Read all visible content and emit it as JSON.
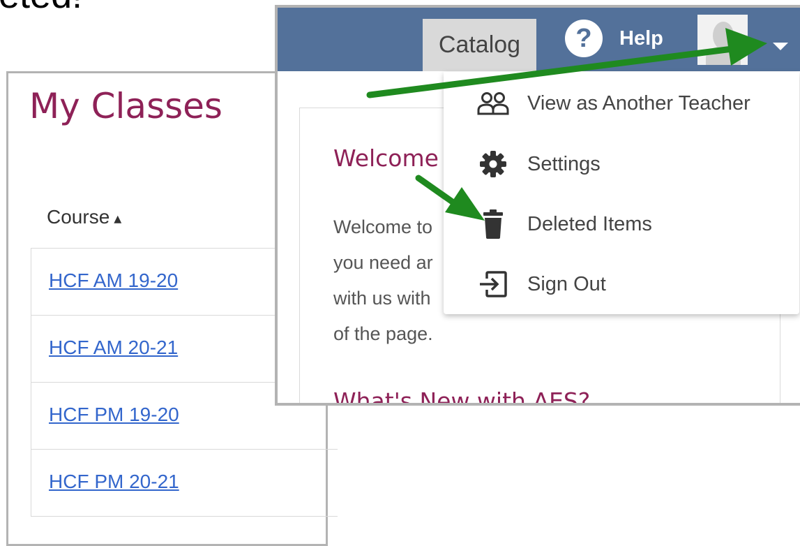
{
  "partial_heading": "eted!",
  "my_classes": {
    "title": "My Classes",
    "column_header": "Course",
    "courses": [
      "HCF AM 19-20",
      "HCF AM 20-21",
      "HCF PM 19-20",
      "HCF PM 20-21"
    ]
  },
  "navbar": {
    "catalog_label": "Catalog",
    "help_label": "Help",
    "help_icon_glyph": "?",
    "background_color": "#53719a"
  },
  "dropdown": {
    "items": [
      {
        "label": "View as Another Teacher",
        "icon": "people-icon"
      },
      {
        "label": "Settings",
        "icon": "gear-icon"
      },
      {
        "label": "Deleted Items",
        "icon": "trash-icon"
      },
      {
        "label": "Sign Out",
        "icon": "sign-out-icon"
      }
    ]
  },
  "welcome": {
    "title": "Welcome",
    "lines": [
      "Welcome to",
      "you need ar",
      "with us with",
      "of the page."
    ],
    "whats_new": "What's New with AES?"
  },
  "colors": {
    "heading_accent": "#8e2157",
    "link": "#3366cc",
    "annotation_arrow": "#1f8a1f"
  }
}
